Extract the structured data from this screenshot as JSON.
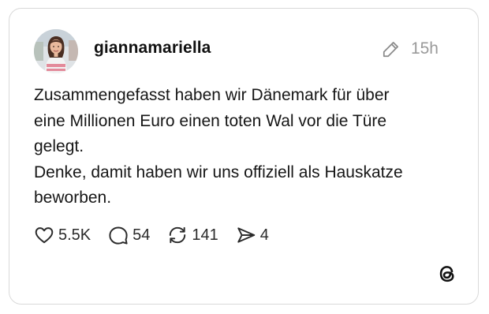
{
  "post": {
    "username": "giannamariella",
    "time": "15h",
    "text": [
      "Zusammengefasst haben wir Dänemark für über",
      "eine Millionen Euro einen toten Wal vor die Türe",
      "gelegt.",
      "Denke, damit haben wir uns offiziell als Hauskatze",
      "beworben."
    ],
    "stats": {
      "likes": "5.5K",
      "replies": "54",
      "reposts": "141",
      "shares": "4"
    }
  },
  "icons": {
    "edit": "pencil-icon",
    "like": "heart-icon",
    "reply": "comment-icon",
    "repost": "repost-icon",
    "share": "send-icon",
    "brand": "threads-logo"
  },
  "colors": {
    "text": "#161616",
    "muted": "#9a9a9a",
    "border": "#d9d9d9"
  }
}
